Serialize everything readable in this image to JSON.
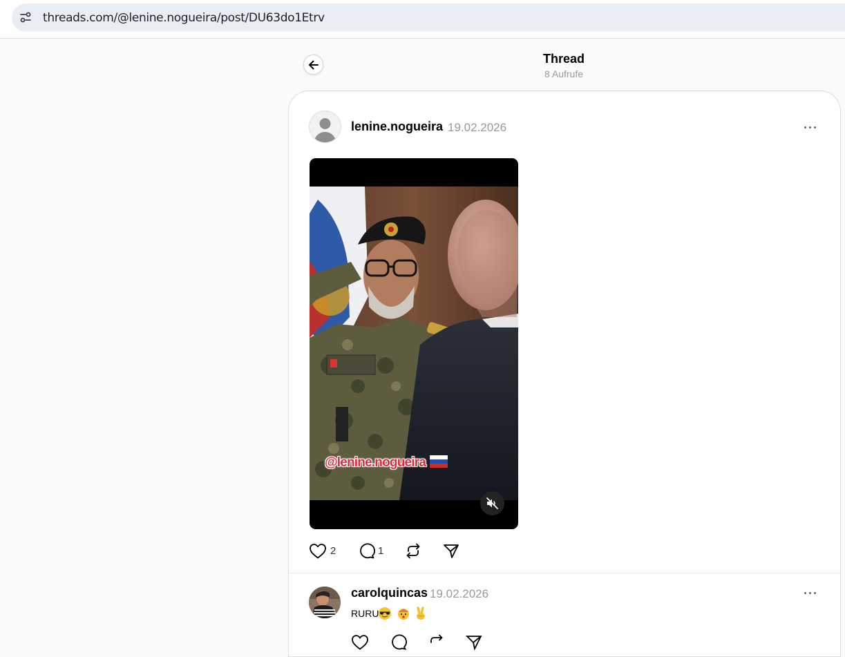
{
  "browser": {
    "url": "threads.com/@lenine.nogueira/post/DU63do1Etrv"
  },
  "header": {
    "title": "Thread",
    "subtitle": "8 Aufrufe"
  },
  "post": {
    "username": "lenine.nogueira",
    "date": "19.02.2026",
    "video_overlay_text": "@lenine.nogueira",
    "likes": "2",
    "replies": "1"
  },
  "reply": {
    "username": "carolquincas",
    "date": "19.02.2026",
    "text": "RURU"
  },
  "colors": {
    "accent": "#000000",
    "muted": "#999999",
    "overlay_text": "#e8283c",
    "address_bar": "#e9eef6"
  }
}
